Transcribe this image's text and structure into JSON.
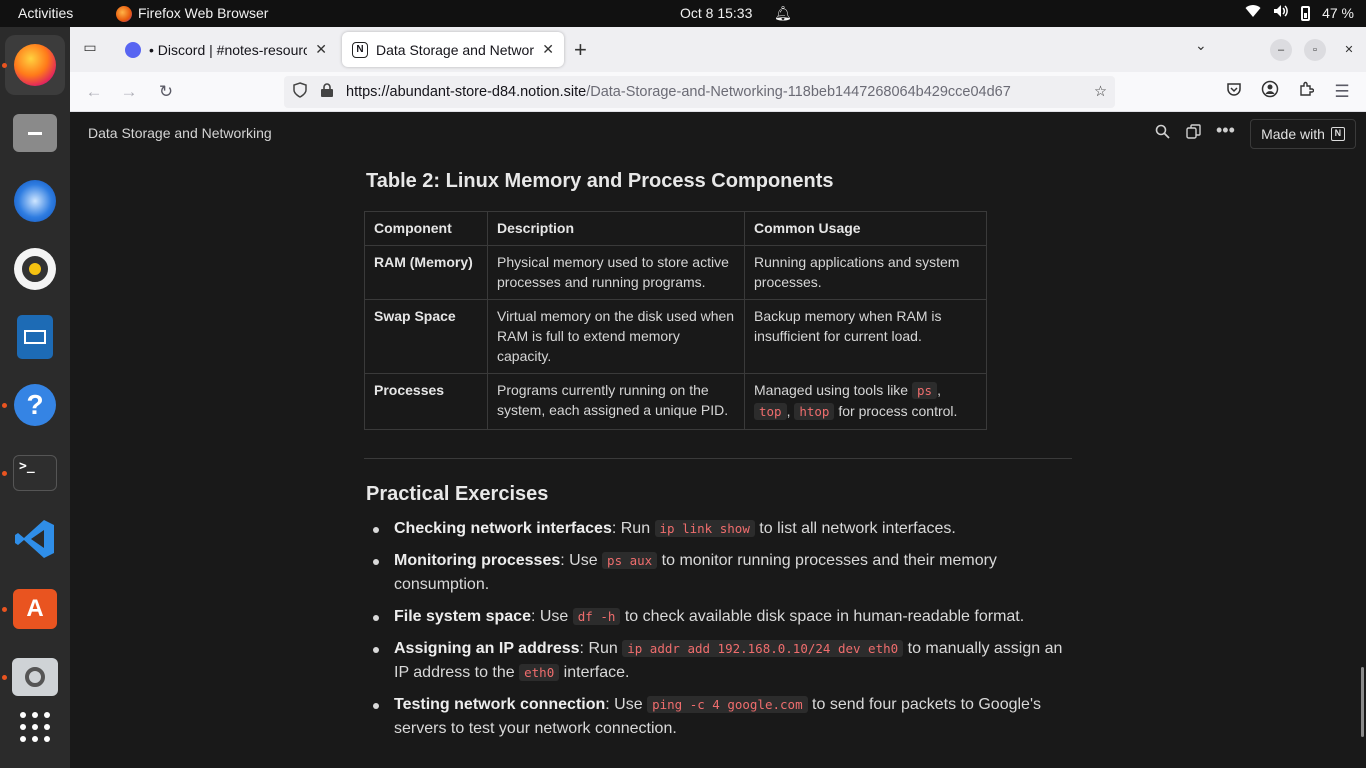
{
  "topbar": {
    "activities": "Activities",
    "app_name": "Firefox Web Browser",
    "clock": "Oct 8  15:33",
    "battery": "47 %"
  },
  "dock": {
    "items": [
      "firefox",
      "files",
      "thunderbird",
      "rhythmbox",
      "libreoffice-writer",
      "help",
      "terminal",
      "vscode",
      "app-center",
      "image-viewer",
      "show-apps"
    ]
  },
  "browser": {
    "tabs": [
      {
        "title": "• Discord | #notes-resources"
      },
      {
        "title": "Data Storage and Networking"
      }
    ],
    "url_host": "https://abundant-store-d84.notion.site",
    "url_path": "/Data-Storage-and-Networking-118beb1447268064b429cce04d67"
  },
  "notion": {
    "crumb": "Data Storage and Networking",
    "made_with": "Made with"
  },
  "table": {
    "heading": "Table 2: Linux Memory and Process Components",
    "headers": [
      "Component",
      "Description",
      "Common Usage"
    ],
    "rows": [
      {
        "component": "RAM (Memory)",
        "description": "Physical memory used to store active processes and running programs.",
        "usage": "Running applications and system processes."
      },
      {
        "component": "Swap Space",
        "description": "Virtual memory on the disk used when RAM is full to extend memory capacity.",
        "usage": "Backup memory when RAM is insufficient for current load."
      },
      {
        "component": "Processes",
        "description": "Programs currently running on the system, each assigned a unique PID.",
        "usage_pre": "Managed using tools like ",
        "code1": "ps",
        "sep1": ", ",
        "code2": "top",
        "sep2": ", ",
        "code3": "htop",
        "usage_post": " for process control."
      }
    ]
  },
  "exercises": {
    "heading": "Practical Exercises",
    "items": [
      {
        "title": "Checking network interfaces",
        "pre": ": Run ",
        "code": "ip link show",
        "post": " to list all network interfaces."
      },
      {
        "title": "Monitoring processes",
        "pre": ": Use ",
        "code": "ps aux",
        "post": " to monitor running processes and their memory consumption."
      },
      {
        "title": "File system space",
        "pre": ": Use ",
        "code": "df -h",
        "post": " to check available disk space in human-readable format."
      },
      {
        "title": "Assigning an IP address",
        "pre": ": Run ",
        "code": "ip addr add 192.168.0.10/24 dev eth0",
        "post": " to manually assign an IP address to the ",
        "code2": "eth0",
        "post2": " interface."
      },
      {
        "title": "Testing network connection",
        "pre": ": Use ",
        "code": "ping -c 4 google.com",
        "post": " to send four packets to Google's servers to test your network connection."
      }
    ]
  }
}
